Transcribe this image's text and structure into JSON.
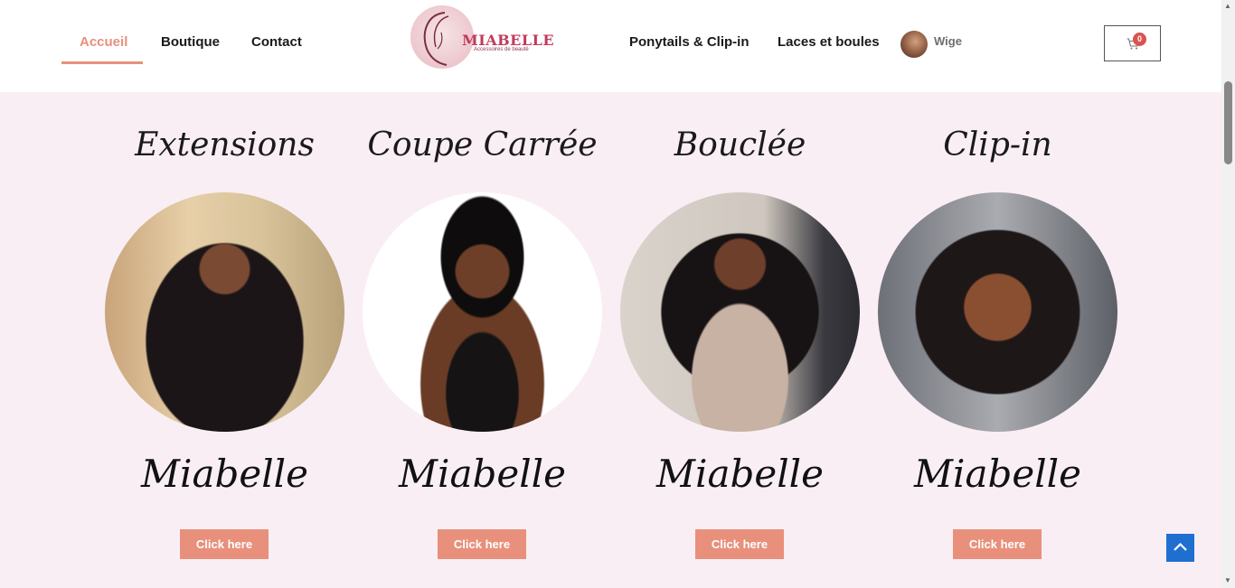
{
  "nav": {
    "home": "Accueil",
    "shop": "Boutique",
    "contact": "Contact",
    "ponytails": "Ponytails & Clip-in",
    "laces": "Laces et boules",
    "user": "Wige"
  },
  "logo": {
    "brand": "MIABELLE",
    "tagline": "Accessoires de beauté"
  },
  "cart": {
    "count": "0"
  },
  "columns": [
    {
      "title": "Extensions",
      "brand": "Miabelle",
      "button": "Click here"
    },
    {
      "title": "Coupe Carrée",
      "brand": "Miabelle",
      "button": "Click here"
    },
    {
      "title": "Bouclée",
      "brand": "Miabelle",
      "button": "Click here"
    },
    {
      "title": "Clip-in",
      "brand": "Miabelle",
      "button": "Click here"
    }
  ],
  "colors": {
    "accent": "#e8907c",
    "background": "#f9eef4",
    "scroll_top_button": "#1f6fd1",
    "cart_badge": "#d9534f"
  }
}
